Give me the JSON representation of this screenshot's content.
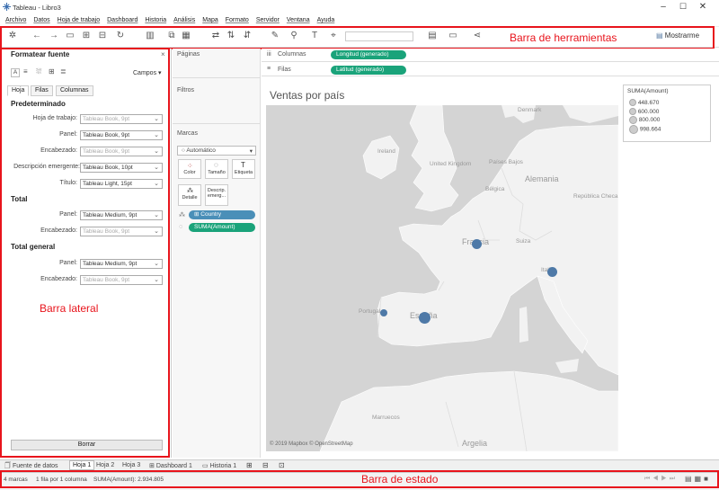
{
  "window": {
    "title": "Tableau - Libro3"
  },
  "menu": [
    "Archivo",
    "Datos",
    "Hoja de trabajo",
    "Dashboard",
    "Historia",
    "Análisis",
    "Mapa",
    "Formato",
    "Servidor",
    "Ventana",
    "Ayuda"
  ],
  "toolbar": {
    "show_me": "Mostrarme",
    "annotation": "Barra de herramientas"
  },
  "sidebar": {
    "title": "Formatear fuente",
    "fields_button": "Campos",
    "tabs": [
      "Hoja",
      "Filas",
      "Columnas"
    ],
    "sections": {
      "predeterminado": "Predeterminado",
      "total": "Total",
      "total_general": "Total general"
    },
    "rows": {
      "hoja_label": "Hoja de trabajo:",
      "hoja_value": "Tableau Book, 9pt",
      "panel_label": "Panel:",
      "panel_value": "Tableau Book, 9pt",
      "enc_label": "Encabezado:",
      "enc_value": "Tableau Book, 9pt",
      "desc_label": "Descripción emergente:",
      "desc_value": "Tableau Book, 10pt",
      "titulo_label": "Título:",
      "titulo_value": "Tableau Light, 15pt",
      "t_panel_label": "Panel:",
      "t_panel_value": "Tableau Medium, 9pt",
      "t_enc_label": "Encabezado:",
      "t_enc_value": "Tableau Book, 9pt",
      "tg_panel_label": "Panel:",
      "tg_panel_value": "Tableau Medium, 9pt",
      "tg_enc_label": "Encabezado:",
      "tg_enc_value": "Tableau Book, 9pt"
    },
    "clear_button": "Borrar",
    "annotation": "Barra lateral"
  },
  "cards": {
    "pages": "Páginas",
    "filters": "Filtros",
    "marks": "Marcas",
    "mark_type": "Automático",
    "color": "Color",
    "size": "Tamaño",
    "label": "Etiqueta",
    "detail": "Detalle",
    "tooltip": "Descrip. emerg...",
    "pill_country": "Country",
    "pill_amount": "SUMA(Amount)"
  },
  "shelves": {
    "columns_label": "Columnas",
    "columns_pill": "Longitud (generado)",
    "rows_label": "Filas",
    "rows_pill": "Latitud (generado)"
  },
  "view": {
    "title": "Ventas por país",
    "attribution": "© 2019 Mapbox © OpenStreetMap",
    "places": [
      "Denmark",
      "Ireland",
      "United Kingdom",
      "Países Bajos",
      "Bélgica",
      "Alemania",
      "República Checa",
      "Francia",
      "Suiza",
      "Italia",
      "Portugal",
      "España",
      "Marruecos",
      "Argelia"
    ]
  },
  "legend": {
    "title": "SUMA(Amount)",
    "items": [
      "448.670",
      "600.000",
      "800.000",
      "998.664"
    ]
  },
  "sheet_tabs": [
    "Fuente de datos",
    "Hoja 1",
    "Hoja 2",
    "Hoja 3",
    "Dashboard 1",
    "Historia 1"
  ],
  "status": {
    "marks": "4 marcas",
    "rows": "1 fila por 1 columna",
    "sum": "SUMA(Amount): 2.934.805",
    "annotation": "Barra de estado"
  },
  "colors": {
    "accent": "#1aa37a",
    "pill_blue": "#4a8fb8",
    "mark": "#4e79a7",
    "annotation_red": "#e8141c"
  }
}
